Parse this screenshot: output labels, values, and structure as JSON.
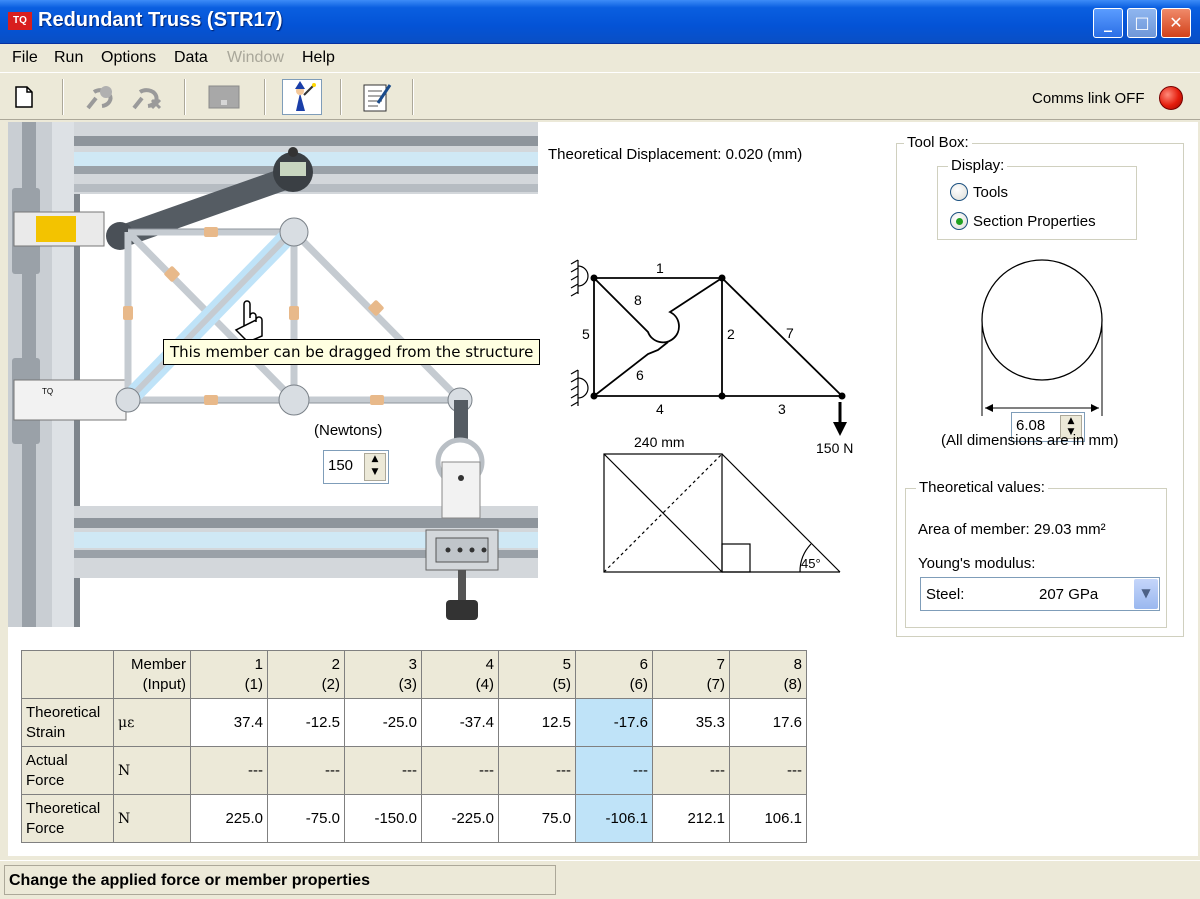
{
  "window": {
    "title": "Redundant Truss (STR17)",
    "logo_text": "TQ"
  },
  "menu": {
    "items": [
      "File",
      "Run",
      "Options",
      "Data",
      "Window",
      "Help"
    ]
  },
  "toolbar": {
    "comms_label": "Comms link OFF",
    "comms_status_color": "#e41c0c"
  },
  "workspace": {
    "theoretical_displacement": "Theoretical Displacement: 0.020 (mm)",
    "tooltip": "This member can be dragged from the structure",
    "force_unit_label": "(Newtons)",
    "force_value": "150"
  },
  "diagram": {
    "member_labels": [
      "1",
      "2",
      "3",
      "4",
      "5",
      "6",
      "7",
      "8"
    ],
    "load_label": "150 N",
    "dimension_label": "240 mm",
    "angle_label": "45°"
  },
  "toolbox": {
    "title": "Tool Box:",
    "display_group": "Display:",
    "option_tools": "Tools",
    "option_section": "Section Properties",
    "selected_option": "Section Properties",
    "diameter_value": "6.08",
    "dimensions_note": "(All dimensions are in mm)",
    "theoretical_group": "Theoretical values:",
    "area_text": "Area of member: 29.03 mm²",
    "youngs_label": "Young's modulus:",
    "material": "Steel:",
    "modulus": "207 GPa"
  },
  "table": {
    "member_header_line1": "Member",
    "member_header_line2": "(Input)",
    "columns": [
      {
        "top": "1",
        "bottom": "(1)"
      },
      {
        "top": "2",
        "bottom": "(2)"
      },
      {
        "top": "3",
        "bottom": "(3)"
      },
      {
        "top": "4",
        "bottom": "(4)"
      },
      {
        "top": "5",
        "bottom": "(5)"
      },
      {
        "top": "6",
        "bottom": "(6)"
      },
      {
        "top": "7",
        "bottom": "(7)"
      },
      {
        "top": "8",
        "bottom": "(8)"
      }
    ],
    "rows": [
      {
        "label1": "Theoretical",
        "label2": "Strain",
        "unit": "με",
        "values": [
          "37.4",
          "-12.5",
          "-25.0",
          "-37.4",
          "12.5",
          "-17.6",
          "35.3",
          "17.6"
        ]
      },
      {
        "label1": "Actual",
        "label2": "Force",
        "unit": "N",
        "values": [
          "---",
          "---",
          "---",
          "---",
          "---",
          "---",
          "---",
          "---"
        ]
      },
      {
        "label1": "Theoretical",
        "label2": "Force",
        "unit": "N",
        "values": [
          "225.0",
          "-75.0",
          "-150.0",
          "-225.0",
          "75.0",
          "-106.1",
          "212.1",
          "106.1"
        ]
      }
    ],
    "selected_column": 6
  },
  "status": {
    "message": "Change the applied force or member properties"
  }
}
